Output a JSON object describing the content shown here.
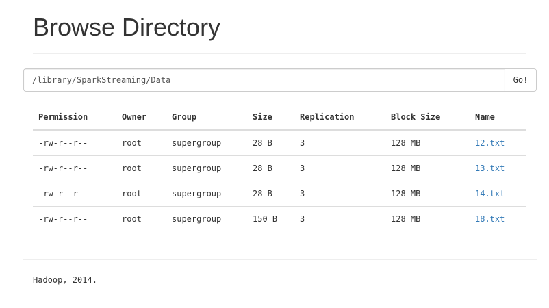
{
  "header": {
    "title": "Browse Directory"
  },
  "path_bar": {
    "value": "/library/SparkStreaming/Data",
    "go_label": "Go!"
  },
  "table": {
    "columns": [
      "Permission",
      "Owner",
      "Group",
      "Size",
      "Replication",
      "Block Size",
      "Name"
    ],
    "rows": [
      {
        "permission": "-rw-r--r--",
        "owner": "root",
        "group": "supergroup",
        "size": "28 B",
        "replication": "3",
        "block_size": "128 MB",
        "name": "12.txt"
      },
      {
        "permission": "-rw-r--r--",
        "owner": "root",
        "group": "supergroup",
        "size": "28 B",
        "replication": "3",
        "block_size": "128 MB",
        "name": "13.txt"
      },
      {
        "permission": "-rw-r--r--",
        "owner": "root",
        "group": "supergroup",
        "size": "28 B",
        "replication": "3",
        "block_size": "128 MB",
        "name": "14.txt"
      },
      {
        "permission": "-rw-r--r--",
        "owner": "root",
        "group": "supergroup",
        "size": "150 B",
        "replication": "3",
        "block_size": "128 MB",
        "name": "18.txt"
      }
    ]
  },
  "footer": {
    "text": "Hadoop, 2014."
  },
  "colors": {
    "link": "#337ab7",
    "text": "#333333",
    "border": "#dddddd"
  }
}
